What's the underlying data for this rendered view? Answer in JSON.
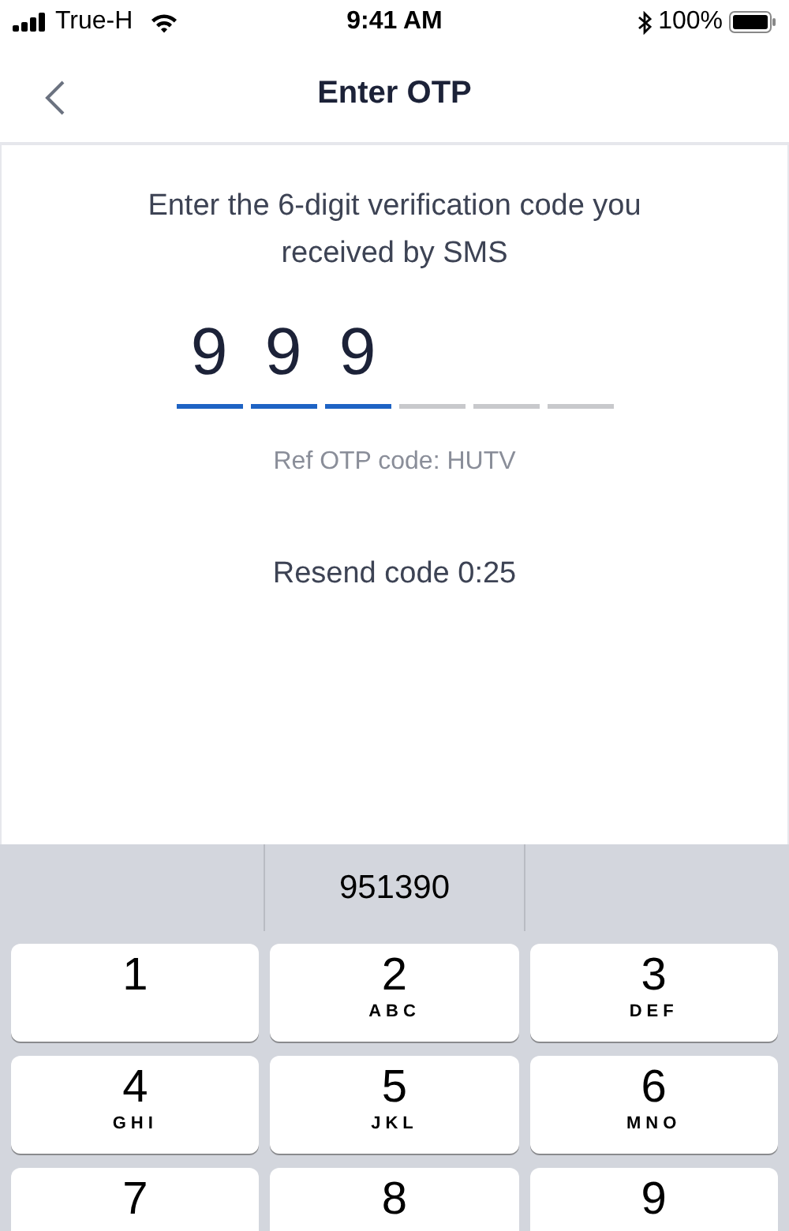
{
  "status_bar": {
    "carrier": "True-H",
    "time": "9:41 AM",
    "battery": "100%"
  },
  "header": {
    "title": "Enter OTP"
  },
  "instructions": "Enter the 6-digit verification code you received by SMS",
  "otp_slots": [
    {
      "digit": "9",
      "filled": true
    },
    {
      "digit": "9",
      "filled": true
    },
    {
      "digit": "9",
      "filled": true
    },
    {
      "filled": false
    },
    {
      "filled": false
    },
    {
      "filled": false
    }
  ],
  "ref_code": "Ref OTP code: HUTV",
  "resend": "Resend code 0:25",
  "keyboard": {
    "suggestions": [
      "951390"
    ],
    "keys": [
      {
        "digit": "1"
      },
      {
        "digit": "2",
        "letters": "ABC"
      },
      {
        "digit": "3",
        "letters": "DEF"
      },
      {
        "digit": "4",
        "letters": "GHI"
      },
      {
        "digit": "5",
        "letters": "JKL"
      },
      {
        "digit": "6",
        "letters": "MNO"
      },
      {
        "digit": "7"
      },
      {
        "digit": "8"
      },
      {
        "digit": "9"
      }
    ]
  }
}
